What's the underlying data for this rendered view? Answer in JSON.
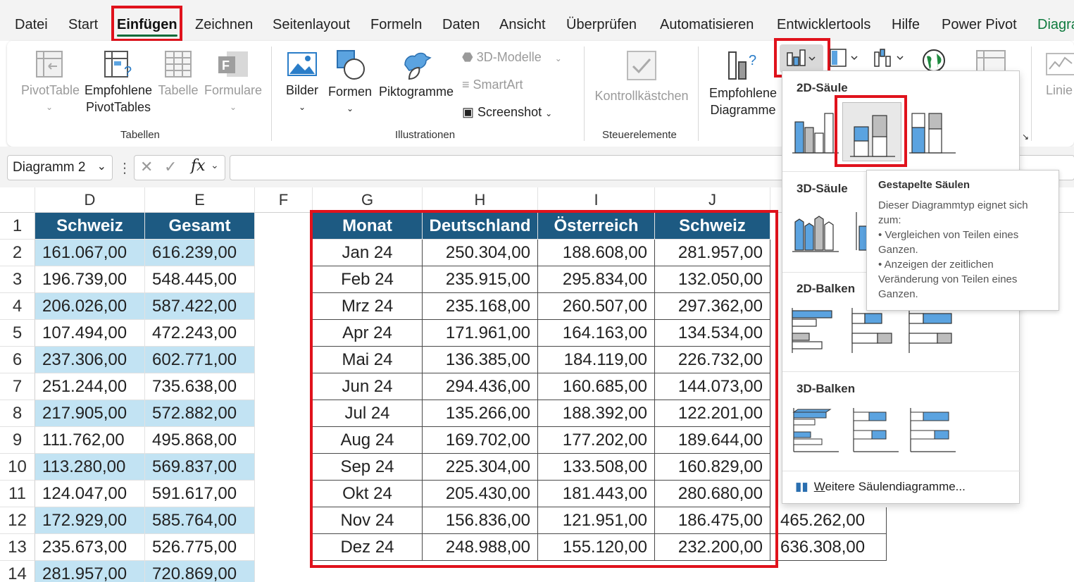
{
  "menu": {
    "tabs": [
      "Datei",
      "Start",
      "Einfügen",
      "Zeichnen",
      "Seitenlayout",
      "Formeln",
      "Daten",
      "Ansicht",
      "Überprüfen",
      "Automatisieren",
      "Entwicklertools",
      "Hilfe",
      "Power Pivot",
      "Diagra"
    ],
    "active": "Einfügen"
  },
  "ribbon": {
    "tabellen": {
      "label": "Tabellen",
      "pivottable": "PivotTable",
      "empfohlene_pivot_1": "Empfohlene",
      "empfohlene_pivot_2": "PivotTables",
      "tabelle": "Tabelle",
      "formulare": "Formulare"
    },
    "illustrationen": {
      "label": "Illustrationen",
      "bilder": "Bilder",
      "formen": "Formen",
      "piktogramme": "Piktogramme",
      "modelle3d": "3D-Modelle",
      "smartart": "SmartArt",
      "screenshot": "Screenshot"
    },
    "steuerelemente": {
      "label": "Steuerelemente",
      "kontrollkaestchen": "Kontrollkästchen"
    },
    "diagramme": {
      "empfohlene_1": "Empfohlene",
      "empfohlene_2": "Diagramme",
      "linie": "Linie"
    }
  },
  "formula_bar": {
    "name_box": "Diagramm 2",
    "fx": "fx",
    "formula": ""
  },
  "columns": [
    "D",
    "E",
    "F",
    "G",
    "H",
    "I",
    "J"
  ],
  "rows": [
    "1",
    "2",
    "3",
    "4",
    "5",
    "6",
    "7",
    "8",
    "9",
    "10",
    "11",
    "12",
    "13",
    "14"
  ],
  "left_table": {
    "headers": [
      "Schweiz",
      "Gesamt"
    ],
    "rows": [
      [
        "161.067,00",
        "616.239,00"
      ],
      [
        "196.739,00",
        "548.445,00"
      ],
      [
        "206.026,00",
        "587.422,00"
      ],
      [
        "107.494,00",
        "472.243,00"
      ],
      [
        "237.306,00",
        "602.771,00"
      ],
      [
        "251.244,00",
        "735.638,00"
      ],
      [
        "217.905,00",
        "572.882,00"
      ],
      [
        "111.762,00",
        "495.868,00"
      ],
      [
        "113.280,00",
        "569.837,00"
      ],
      [
        "124.047,00",
        "591.617,00"
      ],
      [
        "172.929,00",
        "585.764,00"
      ],
      [
        "235.673,00",
        "526.775,00"
      ],
      [
        "281.957,00",
        "720.869,00"
      ]
    ]
  },
  "right_table": {
    "headers": [
      "Monat",
      "Deutschland",
      "Österreich",
      "Schweiz"
    ],
    "rows": [
      [
        "Jan 24",
        "250.304,00",
        "188.608,00",
        "281.957,00"
      ],
      [
        "Feb 24",
        "235.915,00",
        "295.834,00",
        "132.050,00"
      ],
      [
        "Mrz 24",
        "235.168,00",
        "260.507,00",
        "297.362,00"
      ],
      [
        "Apr 24",
        "171.961,00",
        "164.163,00",
        "134.534,00"
      ],
      [
        "Mai 24",
        "136.385,00",
        "184.119,00",
        "226.732,00"
      ],
      [
        "Jun 24",
        "294.436,00",
        "160.685,00",
        "144.073,00"
      ],
      [
        "Jul 24",
        "135.266,00",
        "188.392,00",
        "122.201,00"
      ],
      [
        "Aug 24",
        "169.702,00",
        "177.202,00",
        "189.644,00"
      ],
      [
        "Sep 24",
        "225.304,00",
        "133.508,00",
        "160.829,00"
      ],
      [
        "Okt 24",
        "205.430,00",
        "181.443,00",
        "280.680,00"
      ],
      [
        "Nov 24",
        "156.836,00",
        "121.951,00",
        "186.475,00"
      ],
      [
        "Dez 24",
        "248.988,00",
        "155.120,00",
        "232.200,00"
      ]
    ],
    "extra_k12": "465.262,00",
    "extra_k13": "636.308,00"
  },
  "dropdown": {
    "section_2d_column": "2D-Säule",
    "section_3d_column": "3D-Säule",
    "section_2d_bar": "2D-Balken",
    "section_3d_bar": "3D-Balken",
    "more_prefix": "W",
    "more_rest": "eitere Säulendiagramme..."
  },
  "tooltip": {
    "title": "Gestapelte Säulen",
    "line1": "Dieser Diagrammtyp eignet sich zum:",
    "line2": "• Vergleichen von Teilen eines Ganzen.",
    "line3": "• Anzeigen der zeitlichen Veränderung von Teilen eines Ganzen."
  },
  "colors": {
    "header_fill": "#1d5a82",
    "band_fill": "#c2e3f3",
    "highlight_red": "#e0121c",
    "accent_green": "#0e7a3e",
    "chart_blue": "#5ba3e0"
  }
}
